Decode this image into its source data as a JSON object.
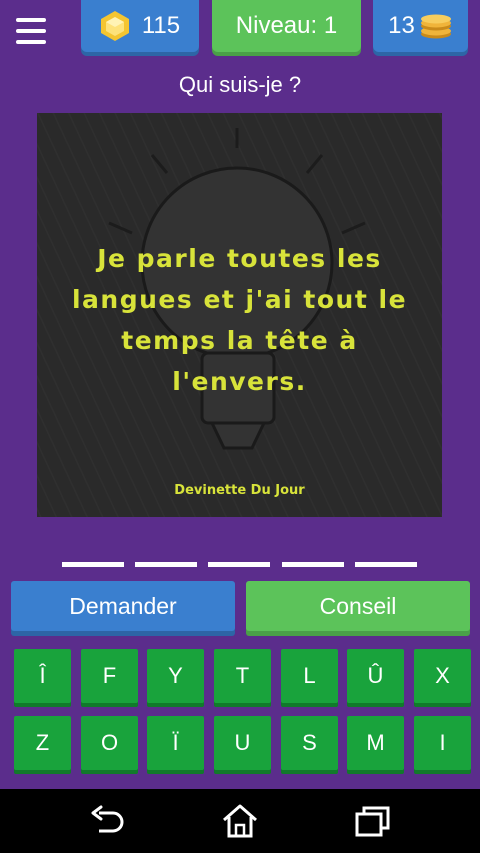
{
  "header": {
    "gems": "115",
    "level_label": "Niveau: 1",
    "coins": "13"
  },
  "question": "Qui suis-je ?",
  "riddle": {
    "text": "Je parle toutes les langues et j'ai tout le temps la tête à l'envers.",
    "source": "Devinette Du Jour"
  },
  "answer_slots": 5,
  "buttons": {
    "ask": "Demander",
    "hint": "Conseil"
  },
  "keyboard": {
    "row1": [
      "Î",
      "F",
      "Y",
      "T",
      "L",
      "Û",
      "X"
    ],
    "row2": [
      "Z",
      "O",
      "Ï",
      "U",
      "S",
      "M",
      "I"
    ]
  },
  "icons": {
    "menu": "hamburger-icon",
    "gems": "hexagon-gem-icon",
    "coins": "coin-stack-icon",
    "nav_back": "back-icon",
    "nav_home": "home-icon",
    "nav_recents": "recent-apps-icon"
  },
  "colors": {
    "background": "#5b2d8c",
    "blue": "#3a7fcf",
    "green": "#5cc35a",
    "key_green": "#19a33c",
    "riddle_text": "#d8e33a"
  }
}
